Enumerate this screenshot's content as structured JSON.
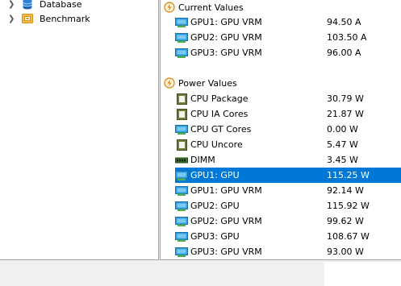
{
  "sidebar": {
    "items": [
      {
        "label": "Database",
        "icon": "database-icon"
      },
      {
        "label": "Benchmark",
        "icon": "benchmark-icon"
      }
    ]
  },
  "sections": {
    "current": {
      "title": "Current Values",
      "rows": [
        {
          "label": "GPU1: GPU VRM",
          "value": "94.50 A",
          "icon": "gpu-icon"
        },
        {
          "label": "GPU2: GPU VRM",
          "value": "103.50 A",
          "icon": "gpu-icon"
        },
        {
          "label": "GPU3: GPU VRM",
          "value": "96.00 A",
          "icon": "gpu-icon"
        }
      ]
    },
    "power": {
      "title": "Power Values",
      "rows": [
        {
          "label": "CPU Package",
          "value": "30.79 W",
          "icon": "cpu-chip-icon"
        },
        {
          "label": "CPU IA Cores",
          "value": "21.87 W",
          "icon": "cpu-chip-icon"
        },
        {
          "label": "CPU GT Cores",
          "value": "0.00 W",
          "icon": "gpu-icon"
        },
        {
          "label": "CPU Uncore",
          "value": "5.47 W",
          "icon": "cpu-chip-icon"
        },
        {
          "label": "DIMM",
          "value": "3.45 W",
          "icon": "memory-icon"
        },
        {
          "label": "GPU1: GPU",
          "value": "115.25 W",
          "icon": "gpu-icon",
          "selected": true
        },
        {
          "label": "GPU1: GPU VRM",
          "value": "92.14 W",
          "icon": "gpu-icon"
        },
        {
          "label": "GPU2: GPU",
          "value": "115.92 W",
          "icon": "gpu-icon"
        },
        {
          "label": "GPU2: GPU VRM",
          "value": "99.62 W",
          "icon": "gpu-icon"
        },
        {
          "label": "GPU3: GPU",
          "value": "108.67 W",
          "icon": "gpu-icon"
        },
        {
          "label": "GPU3: GPU VRM",
          "value": "93.00 W",
          "icon": "gpu-icon"
        }
      ]
    }
  },
  "colors": {
    "selection": "#0078d7",
    "section_icon": "#e07b00"
  }
}
